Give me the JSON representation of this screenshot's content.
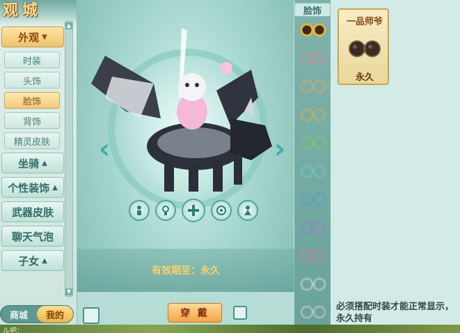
{
  "logo_text": "观城",
  "sidebar": {
    "categories": [
      {
        "label": "外观",
        "expanded": true
      },
      {
        "label": "坐骑",
        "expanded": false
      },
      {
        "label": "个性装饰",
        "expanded": false
      },
      {
        "label": "武器皮肤"
      },
      {
        "label": "聊天气泡"
      },
      {
        "label": "子女",
        "expanded": false
      }
    ],
    "subitems": [
      "时装",
      "头饰",
      "脸饰",
      "背饰",
      "精灵皮肤"
    ],
    "active_subitem": "脸饰",
    "toggle": {
      "shop": "商城",
      "mine": "我的",
      "selected": "我的"
    }
  },
  "preview": {
    "validity_label": "有效期至：",
    "validity_value": "永久",
    "wear_button": "穿 戴"
  },
  "face_column": {
    "title": "脸饰",
    "items": [
      {
        "color": "#e8b534",
        "owned": true
      },
      {
        "color": "#d88a96"
      },
      {
        "color": "#d8a76a"
      },
      {
        "color": "#c7b35a"
      },
      {
        "color": "#7fc76a"
      },
      {
        "color": "#6cc8c8"
      },
      {
        "color": "#5a9ad6"
      },
      {
        "color": "#9a7ad0"
      },
      {
        "color": "#d67aa0"
      },
      {
        "color": "#d0d6d6"
      },
      {
        "color": "#c6cccc"
      }
    ]
  },
  "detail": {
    "item_name": "一品师爷",
    "item_duration": "永久",
    "note_line1": "必须搭配时装才能正常显示，",
    "note_line2": "永久持有"
  },
  "ground_text": "ル吧：",
  "colors": {
    "accent_gold": "#eec46c",
    "teal": "#4aa69b",
    "validity_text": "#f7d36a"
  }
}
